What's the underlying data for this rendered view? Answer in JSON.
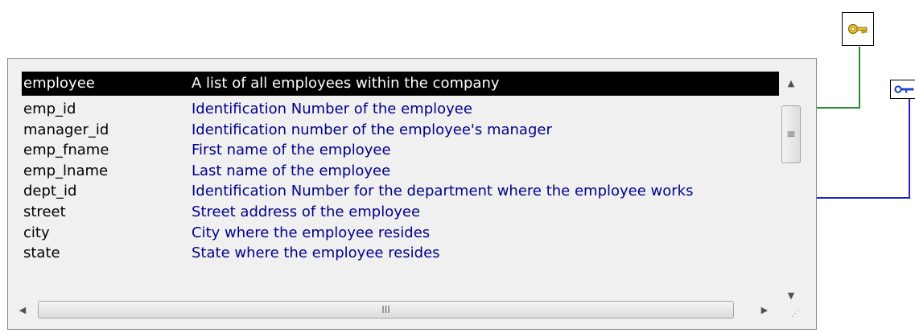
{
  "table": {
    "name": "employee",
    "description": "A list of all employees within the company",
    "columns": [
      {
        "name": "emp_id",
        "description": "Identification Number of the employee"
      },
      {
        "name": "manager_id",
        "description": "Identification number of the employee's manager"
      },
      {
        "name": "emp_fname",
        "description": "First name of the employee"
      },
      {
        "name": "emp_lname",
        "description": "Last name of the employee"
      },
      {
        "name": "dept_id",
        "description": "Identification Number for the department where the employee works"
      },
      {
        "name": "street",
        "description": "Street address of the employee"
      },
      {
        "name": "city",
        "description": "City where the employee resides"
      },
      {
        "name": "state",
        "description": "State where the employee resides"
      }
    ]
  },
  "scrollbar": {
    "thumb_grip": "≡",
    "h_thumb_grip": "III",
    "resize_grip": "⋰"
  },
  "icons": {
    "primary_key": "primary-key-icon",
    "foreign_key": "foreign-key-icon"
  },
  "colors": {
    "header_bg": "#000000",
    "header_text": "#ffffff",
    "description_text": "#00008b",
    "primary_key_line": "#2e8b2e",
    "foreign_key_line": "#2020c8",
    "key_gold": "#d9a400"
  }
}
